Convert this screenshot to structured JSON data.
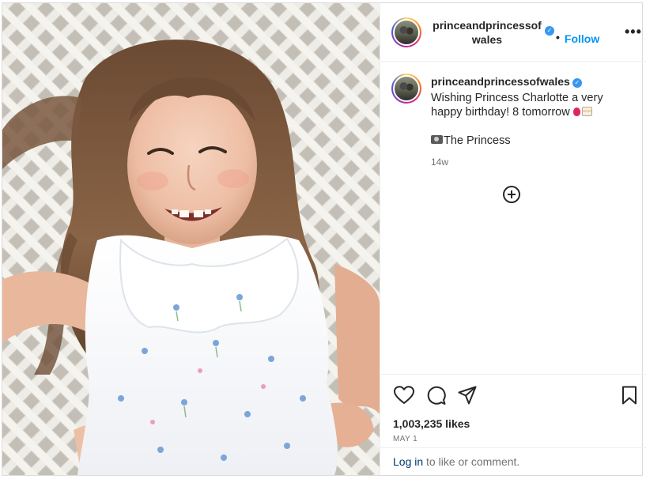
{
  "post": {
    "username": "princeandprincessofwales",
    "header_username_line1": "princeandprincessof",
    "header_username_line2": "wales",
    "verified_mark": "✓",
    "dot": "•",
    "follow_label": "Follow",
    "more_label": "•••",
    "caption_text": "Wishing Princess Charlotte a very happy birthday! 8 tomorrow",
    "caption_emojis": [
      "balloon-emoji",
      "birthday-cake-emoji"
    ],
    "caption_sign_emoji": "camera-flash-emoji",
    "caption_sign": "The Princess",
    "caption_time": "14w",
    "likes": "1,003,235 likes",
    "date": "MAY 1",
    "login_link": "Log in",
    "login_rest": " to like or comment."
  },
  "icons": {
    "like": "heart-icon",
    "comment": "comment-icon",
    "share": "send-icon",
    "save": "bookmark-icon",
    "add_comment": "add-circle-icon",
    "more": "more-horizontal-icon"
  },
  "colors": {
    "accent": "#0095f6",
    "verified": "#3897f0",
    "text": "#262626",
    "secondary": "#737373",
    "link": "#00376b",
    "border": "#dbdbdb"
  }
}
